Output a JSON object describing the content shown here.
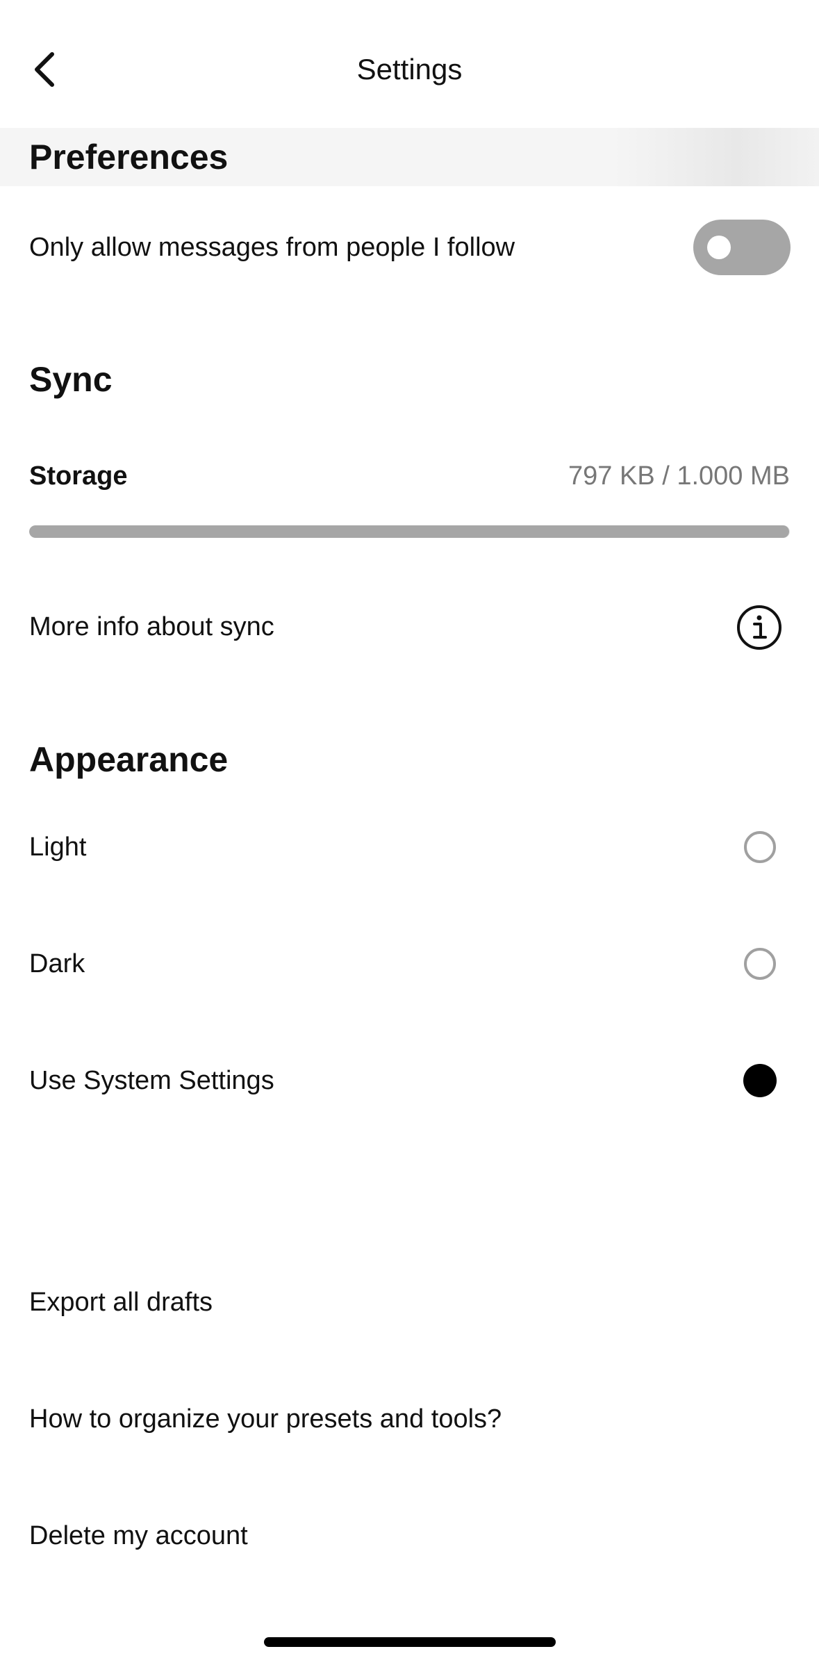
{
  "header": {
    "title": "Settings",
    "back_icon": "chevron-left-icon"
  },
  "preferences": {
    "title": "Preferences",
    "only_follow_label": "Only allow messages from people I follow",
    "only_follow_enabled": false
  },
  "sync": {
    "title": "Sync",
    "storage_label": "Storage",
    "storage_value": "797 KB / 1.000 MB",
    "storage_fraction": 0.999,
    "more_info_label": "More info about sync",
    "info_icon": "info-circle-icon"
  },
  "appearance": {
    "title": "Appearance",
    "options": [
      {
        "label": "Light",
        "selected": false
      },
      {
        "label": "Dark",
        "selected": false
      },
      {
        "label": "Use System Settings",
        "selected": true
      }
    ]
  },
  "actions": {
    "export_label": "Export all drafts",
    "organize_label": "How to organize your presets and tools?",
    "delete_label": "Delete my account"
  },
  "colors": {
    "text": "#111111",
    "muted": "#777777",
    "toggle_off": "#a6a6a6",
    "radio_off": "#a0a0a0",
    "radio_on": "#000000",
    "band": "#f5f5f5"
  }
}
